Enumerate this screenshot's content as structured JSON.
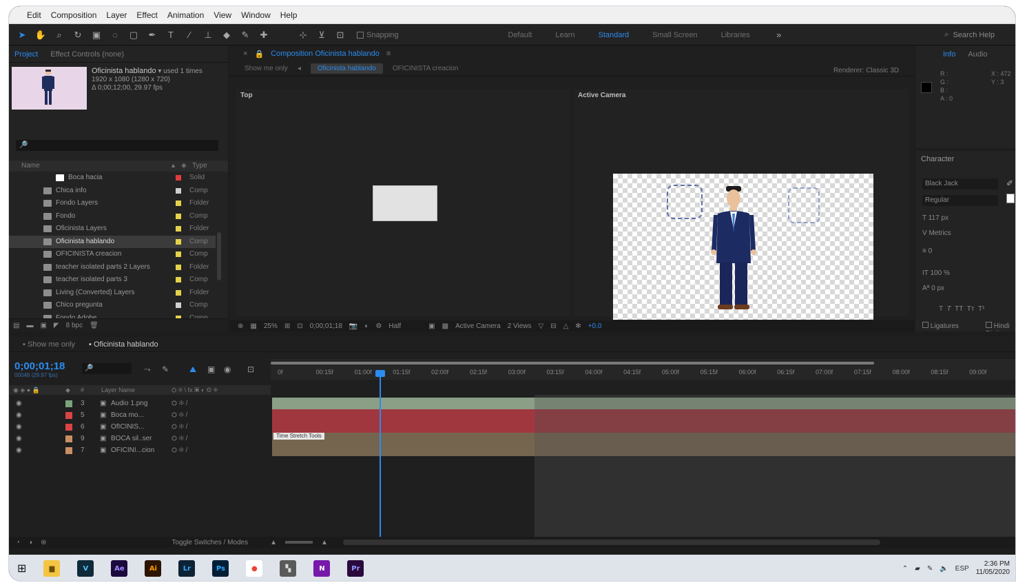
{
  "menu": [
    "Edit",
    "Composition",
    "Layer",
    "Effect",
    "Animation",
    "View",
    "Window",
    "Help"
  ],
  "toolbar": {
    "snapping": "Snapping",
    "workspaces": [
      "Default",
      "Learn",
      "Standard",
      "Small Screen",
      "Libraries"
    ],
    "active_workspace": "Standard",
    "search_placeholder": "Search Help"
  },
  "project": {
    "tabs": [
      "Project",
      "Effect Controls (none)"
    ],
    "selected_name": "Oficinista hablando",
    "selected_used": "used 1 times",
    "selected_meta1": "1920 x 1080 (1280 x 720)",
    "selected_meta2": "Δ 0;00;12;00, 29.97 fps",
    "search_placeholder": "🔎",
    "col_name": "Name",
    "col_type": "Type",
    "items": [
      {
        "name": "Boca hacia",
        "label": "#e23b3b",
        "type": "Solid"
      },
      {
        "name": "Chica info",
        "label": "#cfcfcf",
        "type": "Comp"
      },
      {
        "name": "Fondo Layers",
        "label": "#e5d24b",
        "type": "Folder"
      },
      {
        "name": "Fondo",
        "label": "#e5d24b",
        "type": "Comp"
      },
      {
        "name": "Oficinista Layers",
        "label": "#e5d24b",
        "type": "Folder"
      },
      {
        "name": "Oficinista hablando",
        "label": "#e5d24b",
        "type": "Comp",
        "selected": true
      },
      {
        "name": "OFICINISTA creacion",
        "label": "#e5d24b",
        "type": "Comp"
      },
      {
        "name": "teacher isolated parts 2 Layers",
        "label": "#e5d24b",
        "type": "Folder"
      },
      {
        "name": "teacher isolated parts 3",
        "label": "#e5d24b",
        "type": "Comp"
      },
      {
        "name": "Living (Converted) Layers",
        "label": "#e5d24b",
        "type": "Folder"
      },
      {
        "name": "Chico pregunta",
        "label": "#cfcfcf",
        "type": "Comp"
      },
      {
        "name": "Fondo Adobe",
        "label": "#e5d24b",
        "type": "Comp"
      }
    ],
    "bpc": "8 bpc"
  },
  "composition": {
    "tab": "Composition Oficinista hablando",
    "flow_lock": "Oficinista hablando",
    "flow_prev": "Oficinista hablando",
    "flow_next": "OFICINISTA creacion",
    "show_lock": "Show me only",
    "renderer_label": "Renderer:",
    "renderer_value": "Classic 3D",
    "view_left": "Top",
    "view_right": "Active Camera",
    "footer": {
      "zoom": "25%",
      "time": "0;00;01;18",
      "resolution": "Half",
      "camera": "Active Camera",
      "views": "2 Views",
      "exposure": "+0.0"
    }
  },
  "info": {
    "tabs": [
      "Info",
      "Audio"
    ],
    "rows": [
      "R :",
      "G :",
      "B :",
      "A : 0"
    ],
    "xy": [
      "X : 472",
      "Y : 3"
    ]
  },
  "character": {
    "title": "Character",
    "font": "Black Jack",
    "style": "Regular",
    "size": "117 px",
    "leading": "Metrics",
    "tracking": "0",
    "scale_v": "100 %",
    "baseline": "0 px",
    "ligatures": "Ligatures",
    "hindi": "Hindi Digits"
  },
  "timeline": {
    "tabs": [
      "Show me only",
      "Oficinista hablando"
    ],
    "active_tab": "Oficinista hablando",
    "timecode": "0;00;01;18",
    "timecode_sub": "00048 (29.97 fps)",
    "search_placeholder": "🔎",
    "ticks": [
      "0f",
      "00:15f",
      "01:00f",
      "01:15f",
      "02:00f",
      "02:15f",
      "03:00f",
      "03:15f",
      "04:00f",
      "04:15f",
      "05:00f",
      "05:15f",
      "06:00f",
      "06:15f",
      "07:00f",
      "07:15f",
      "08:00f",
      "08:15f",
      "09:00f"
    ],
    "col_name": "Layer Name",
    "layers": [
      {
        "num": "3",
        "name": "Audio 1.png",
        "label": "#7aa37a",
        "color": "#8a9f86"
      },
      {
        "num": "5",
        "name": "Boca mo...",
        "label": "#d94545",
        "color": "#a0373f"
      },
      {
        "num": "6",
        "name": "OfICINIS...",
        "label": "#d94545",
        "color": "#a0373f"
      },
      {
        "num": "9",
        "name": "BOCA sil..ser",
        "label": "#c98f64",
        "color": "#75654f"
      },
      {
        "num": "7",
        "name": "OFICINI...cion",
        "label": "#c98f64",
        "color": "#75654f"
      }
    ],
    "clip_label": "Time Stretch Tools",
    "toggle": "Toggle Switches / Modes"
  },
  "taskbar": {
    "lang": "ESP",
    "time": "2:36 PM",
    "date": "11/05/2020",
    "apps": [
      {
        "name": "file-explorer-icon",
        "glyph": "▆",
        "bg": "#f4c542",
        "fg": "#6b4e00"
      },
      {
        "name": "vectr-icon",
        "glyph": "V",
        "bg": "#0f2a3a",
        "fg": "#4fc3f7"
      },
      {
        "name": "after-effects-icon",
        "glyph": "Ae",
        "bg": "#1c0a3c",
        "fg": "#9d8cff"
      },
      {
        "name": "illustrator-icon",
        "glyph": "Ai",
        "bg": "#2b1400",
        "fg": "#ff9a00"
      },
      {
        "name": "lightroom-icon",
        "glyph": "Lr",
        "bg": "#0c2235",
        "fg": "#31a8ff"
      },
      {
        "name": "photoshop-icon",
        "glyph": "Ps",
        "bg": "#001e36",
        "fg": "#31a8ff"
      },
      {
        "name": "chrome-icon",
        "glyph": "●",
        "bg": "#ffffff",
        "fg": "#ea4335"
      },
      {
        "name": "app-icon",
        "glyph": "▚",
        "bg": "#5a5a5a",
        "fg": "#dddddd"
      },
      {
        "name": "onenote-icon",
        "glyph": "N",
        "bg": "#7719aa",
        "fg": "#ffffff"
      },
      {
        "name": "premiere-icon",
        "glyph": "Pr",
        "bg": "#2a0a3c",
        "fg": "#9999ff"
      }
    ]
  }
}
